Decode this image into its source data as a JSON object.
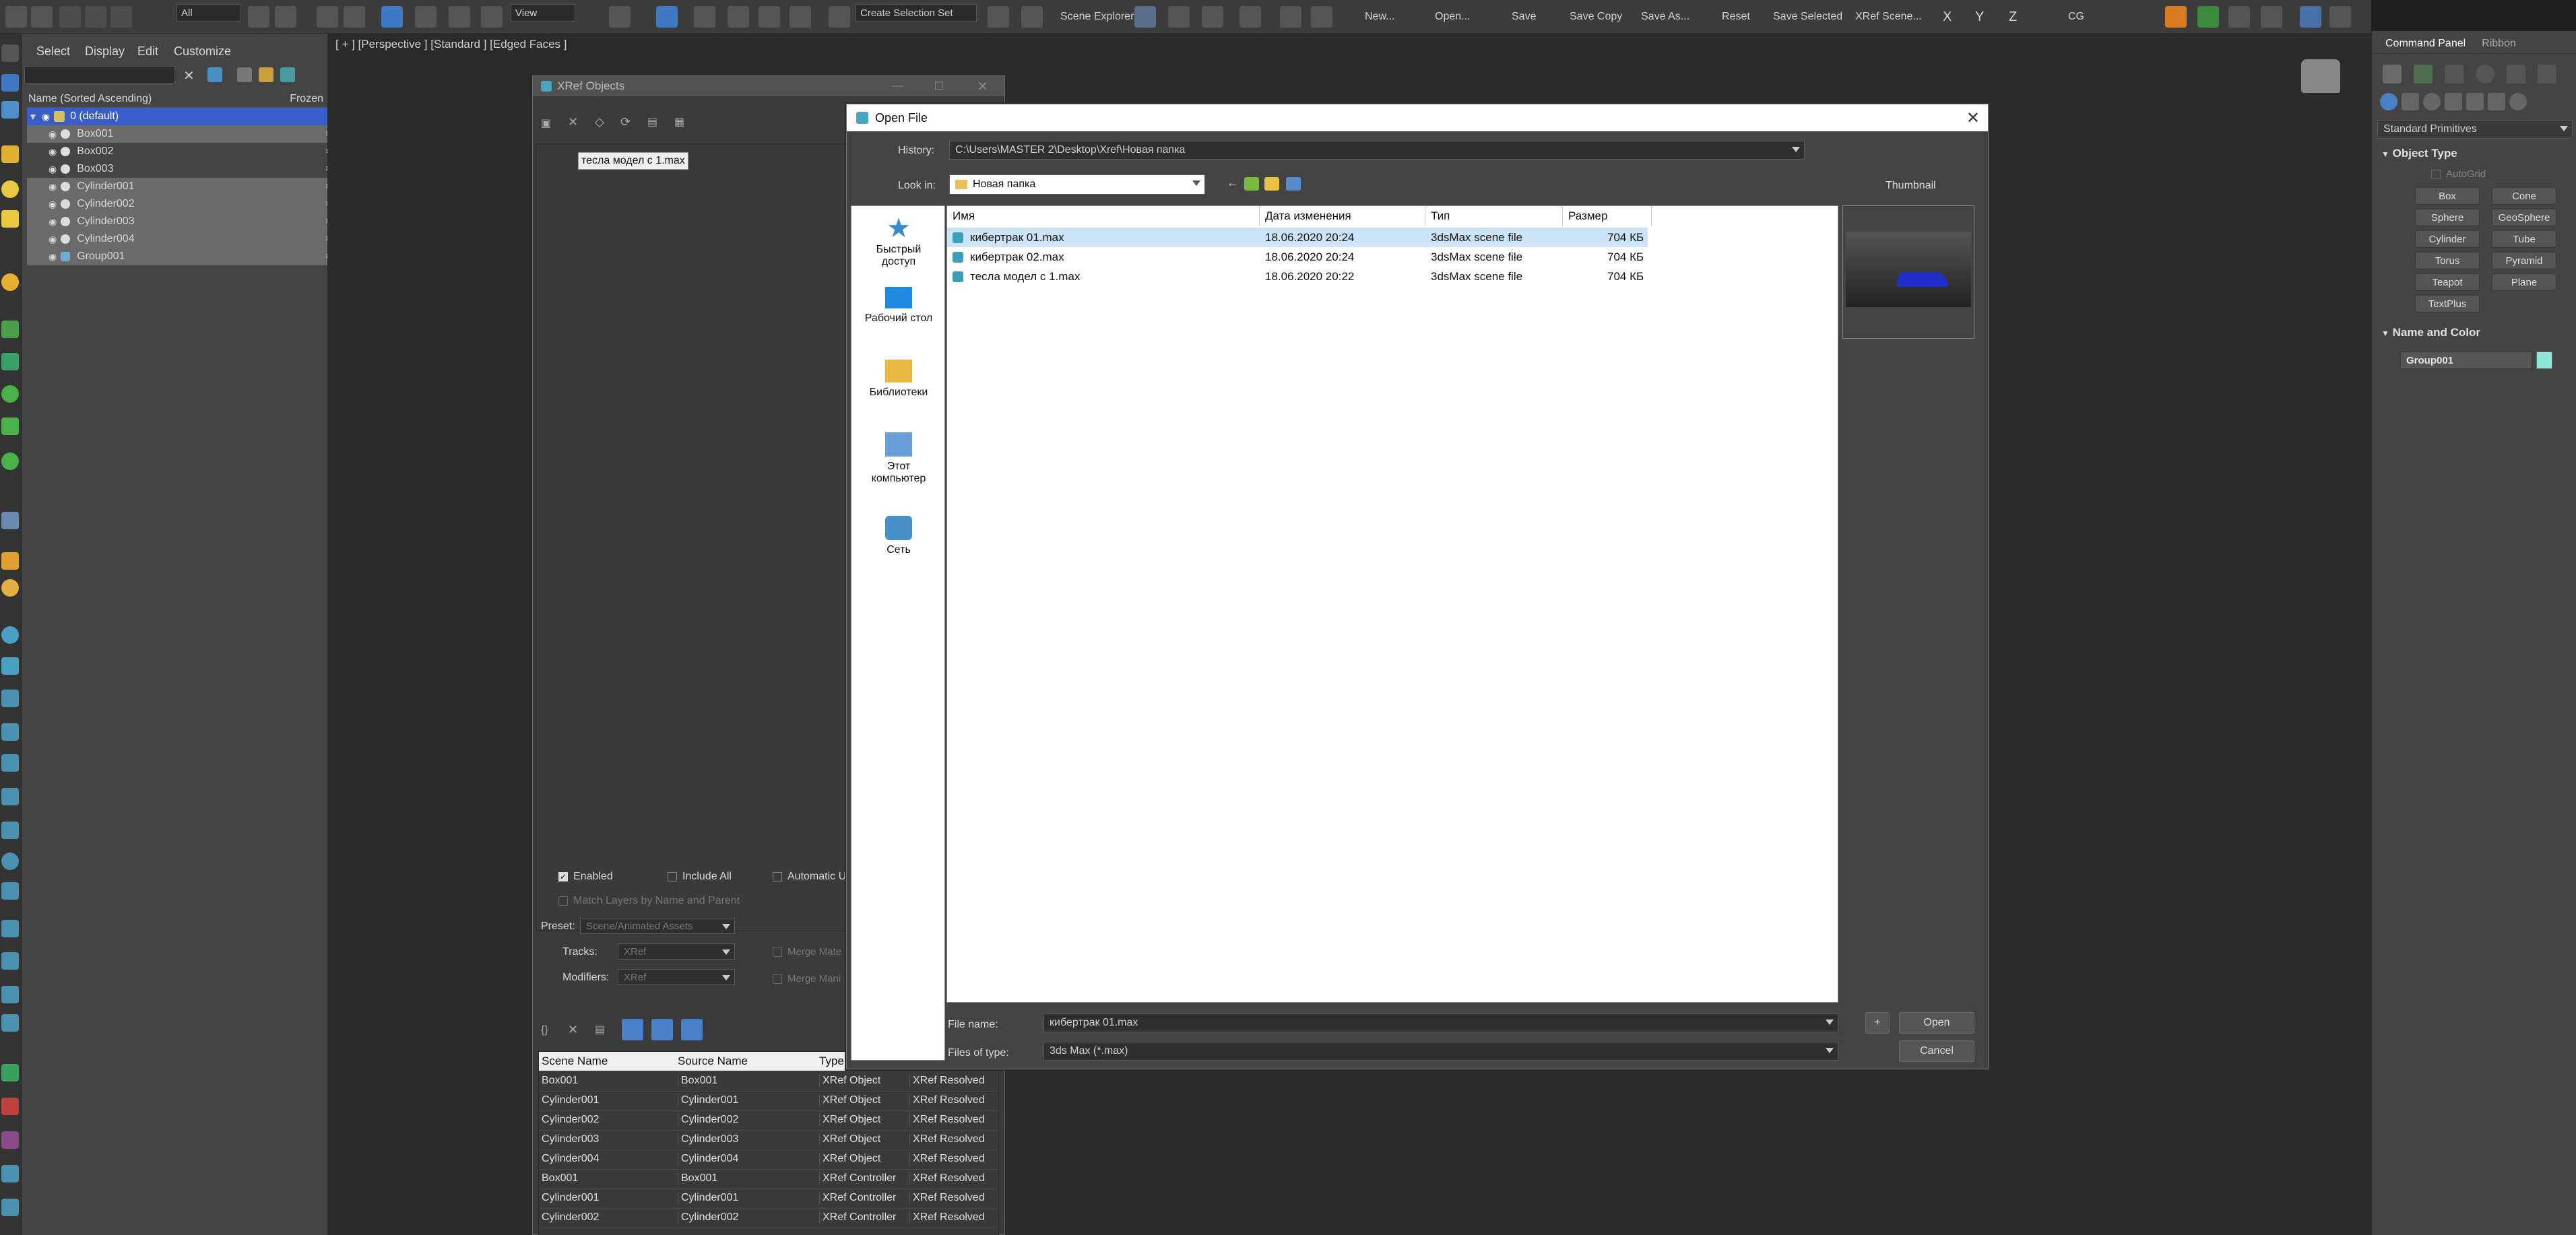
{
  "toolbar": {
    "selection_filter": "All",
    "view_select": "View",
    "create_selection_set": "Create Selection Set",
    "scene_explorer": "Scene Explorer",
    "new": "New...",
    "open": "Open...",
    "save": "Save",
    "save_copy": "Save Copy",
    "save_as": "Save As...",
    "reset": "Reset",
    "save_selected": "Save Selected",
    "xref_scene": "XRef Scene...",
    "axis_x": "X",
    "axis_y": "Y",
    "axis_z": "Z",
    "cg": "CG"
  },
  "scene_explorer": {
    "menu": [
      "Select",
      "Display",
      "Edit",
      "Customize"
    ],
    "column_name": "Name (Sorted Ascending)",
    "column_frozen": "Frozen",
    "layer": "0 (default)",
    "items": [
      "Box001",
      "Box002",
      "Box003",
      "Cylinder001",
      "Cylinder002",
      "Cylinder003",
      "Cylinder004",
      "Group001"
    ]
  },
  "viewport": {
    "label": "[ + ] [Perspective ] [Standard ] [Edged Faces ]"
  },
  "command_panel": {
    "tabs": [
      "Command Panel",
      "Ribbon"
    ],
    "category": "Standard Primitives",
    "object_type_title": "Object Type",
    "autogrid": "AutoGrid",
    "primitives": [
      "Box",
      "Cone",
      "Sphere",
      "GeoSphere",
      "Cylinder",
      "Tube",
      "Torus",
      "Pyramid",
      "Teapot",
      "Plane",
      "TextPlus"
    ],
    "name_color_title": "Name and Color",
    "object_name": "Group001",
    "object_color": "#8ee6d6"
  },
  "xref_window": {
    "title": "XRef Objects",
    "file_entry": "тесла модел с 1.max",
    "enabled": "Enabled",
    "include_all": "Include All",
    "automatic": "Automatic U",
    "match_layers": "Match Layers by Name and Parent",
    "preset_label": "Preset:",
    "preset_value": "Scene/Animated Assets",
    "tracks_label": "Tracks:",
    "tracks_value": "XRef",
    "modifiers_label": "Modifiers:",
    "modifiers_value": "XRef",
    "merge_mat": "Merge Mate",
    "merge_manip": "Merge Mani",
    "table_headers": [
      "Scene Name",
      "Source Name",
      "Type"
    ],
    "rows": [
      [
        "Box001",
        "Box001",
        "XRef Object",
        "XRef Resolved"
      ],
      [
        "Cylinder001",
        "Cylinder001",
        "XRef Object",
        "XRef Resolved"
      ],
      [
        "Cylinder002",
        "Cylinder002",
        "XRef Object",
        "XRef Resolved"
      ],
      [
        "Cylinder003",
        "Cylinder003",
        "XRef Object",
        "XRef Resolved"
      ],
      [
        "Cylinder004",
        "Cylinder004",
        "XRef Object",
        "XRef Resolved"
      ],
      [
        "Box001",
        "Box001",
        "XRef Controller",
        "XRef Resolved"
      ],
      [
        "Cylinder001",
        "Cylinder001",
        "XRef Controller",
        "XRef Resolved"
      ],
      [
        "Cylinder002",
        "Cylinder002",
        "XRef Controller",
        "XRef Resolved"
      ]
    ]
  },
  "open_file": {
    "title": "Open File",
    "history_label": "History:",
    "history_value": "C:\\Users\\MASTER 2\\Desktop\\Xref\\Новая папка",
    "lookin_label": "Look in:",
    "lookin_value": "Новая папка",
    "thumbnail_label": "Thumbnail",
    "places": [
      "Быстрый доступ",
      "Рабочий стол",
      "Библиотеки",
      "Этот компьютер",
      "Сеть"
    ],
    "columns": [
      "Имя",
      "Дата изменения",
      "Тип",
      "Размер"
    ],
    "files": [
      {
        "name": "кибертрак 01.max",
        "date": "18.06.2020 20:24",
        "type": "3dsMax scene file",
        "size": "704 КБ"
      },
      {
        "name": "кибертрак 02.max",
        "date": "18.06.2020 20:24",
        "type": "3dsMax scene file",
        "size": "704 КБ"
      },
      {
        "name": "тесла модел с 1.max",
        "date": "18.06.2020 20:22",
        "type": "3dsMax scene file",
        "size": "704 КБ"
      }
    ],
    "file_name_label": "File name:",
    "file_name_value": "кибертрак 01.max",
    "file_type_label": "Files of type:",
    "file_type_value": "3ds Max (*.max)",
    "plus_button": "+",
    "open_button": "Open",
    "cancel_button": "Cancel"
  }
}
